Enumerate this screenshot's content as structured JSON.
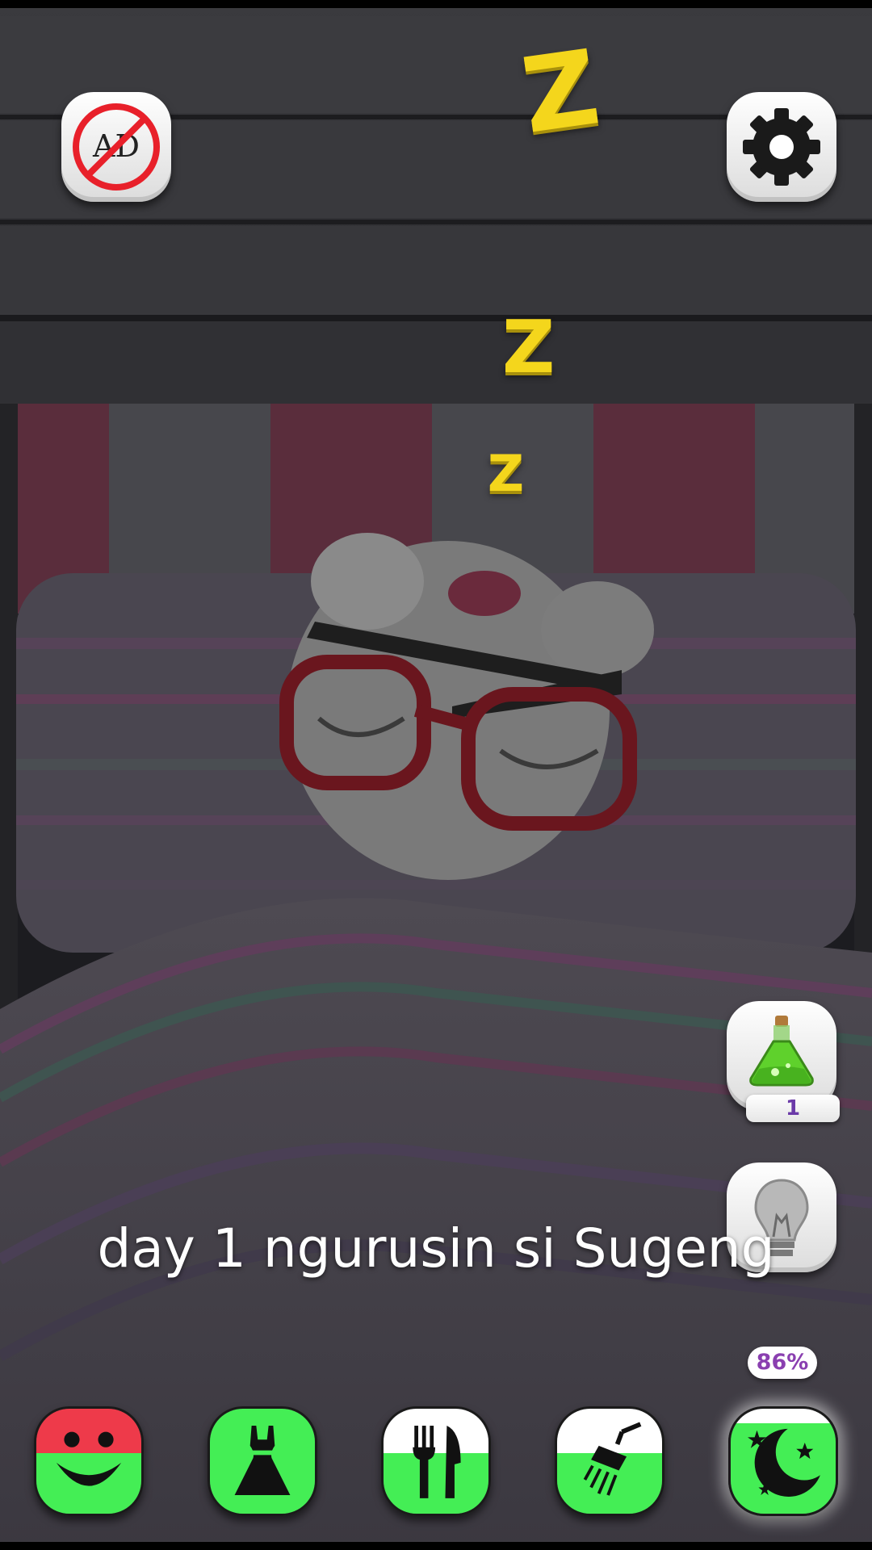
{
  "caption": "day 1 ngurusin si Sugeng",
  "zzz": [
    "Z",
    "Z",
    "Z"
  ],
  "buttons": {
    "no_ads": {
      "label": "AD",
      "icon": "no-ads-icon"
    },
    "settings": {
      "icon": "gear-icon"
    },
    "potion": {
      "icon": "potion-icon",
      "count": "1"
    },
    "lightbulb": {
      "icon": "lightbulb-icon"
    }
  },
  "bottom_nav": {
    "items": [
      {
        "name": "happiness",
        "icon": "smiley-icon",
        "level": 0.58,
        "accent": "#ee3a4a"
      },
      {
        "name": "wardrobe",
        "icon": "dress-icon",
        "level": 1.0,
        "accent": "#44ee55"
      },
      {
        "name": "food",
        "icon": "fork-knife-icon",
        "level": 0.58,
        "accent": "#44ee55"
      },
      {
        "name": "hygiene",
        "icon": "shower-icon",
        "level": 0.58,
        "accent": "#44ee55"
      },
      {
        "name": "sleep",
        "icon": "moon-stars-icon",
        "level": 0.86,
        "accent": "#44ee55"
      }
    ],
    "sleep_percent": "86%"
  },
  "colors": {
    "accent_green": "#44ee55",
    "accent_red": "#ee3a4a",
    "zzz_yellow": "#f4d61c",
    "percent_purple": "#8a3fb0"
  }
}
